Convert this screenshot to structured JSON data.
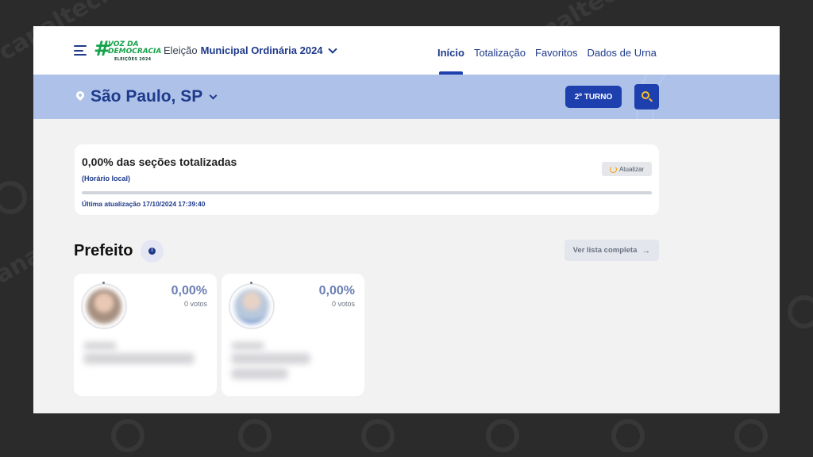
{
  "header": {
    "logo": {
      "hash": "#",
      "line1": "VOZ DA",
      "line2": "DEMOCRACIA",
      "line3": "ELEIÇÕES 2024"
    },
    "election_prefix": "Eleição",
    "election_name": "Municipal Ordinária 2024",
    "nav": [
      {
        "label": "Início",
        "active": true
      },
      {
        "label": "Totalização",
        "active": false
      },
      {
        "label": "Favoritos",
        "active": false
      },
      {
        "label": "Dados de Urna",
        "active": false
      }
    ]
  },
  "location": {
    "city": "São Paulo, SP",
    "turno_label": "2º TURNO"
  },
  "status": {
    "title": "0,00% das seções totalizadas",
    "subtitle": "(Horário local)",
    "refresh_label": "Atualizar",
    "last_update": "Última atualização 17/10/2024 17:39:40",
    "progress_fraction": 0
  },
  "section": {
    "title": "Prefeito",
    "info_glyph": "i",
    "list_button": "Ver lista completa",
    "list_arrow": "→"
  },
  "candidates": [
    {
      "percent": "0,00%",
      "votes": "0 votos"
    },
    {
      "percent": "0,00%",
      "votes": "0 votos"
    }
  ],
  "watermark": "canaltech",
  "colors": {
    "primary": "#1e40af",
    "band": "#aec2e9",
    "logo_green": "#14a34a",
    "accent_yellow": "#fbbf24"
  },
  "icons": [
    "menu-icon",
    "location-pin-icon",
    "chevron-down-icon",
    "search-icon",
    "refresh-icon",
    "info-icon",
    "arrow-right-icon"
  ]
}
